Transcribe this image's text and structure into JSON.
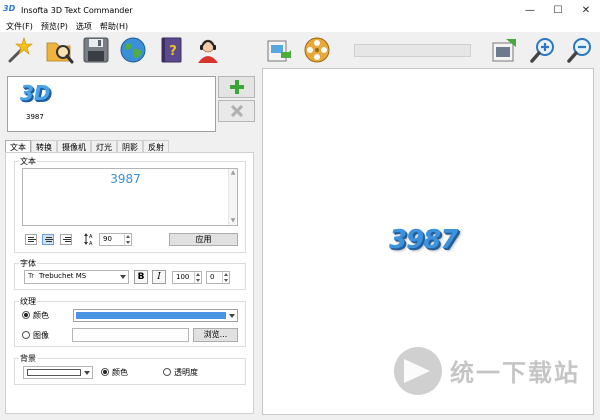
{
  "window": {
    "title": "Insofta 3D Text Commander",
    "minimize": "—",
    "maximize": "☐",
    "close": "✕"
  },
  "menu": [
    "文件(F)",
    "预览(P)",
    "选项",
    "帮助(H)"
  ],
  "toolbar": {
    "icons": [
      "magic-wand-icon",
      "open-folder-icon",
      "save-disk-icon",
      "globe-icon",
      "help-book-icon",
      "support-agent-icon",
      "export-image-icon",
      "film-reel-icon",
      "render-progress-icon",
      "zoom-in-icon",
      "zoom-out-icon"
    ]
  },
  "thumbnails": [
    {
      "glyph": "3D",
      "label": "3987"
    }
  ],
  "side_buttons": {
    "add": "+",
    "remove": "✕"
  },
  "tabs": [
    "文本",
    "转换",
    "摄像机",
    "灯光",
    "阴影",
    "反射"
  ],
  "text_group": {
    "label": "文本",
    "value": "3987",
    "line_spacing": "90",
    "apply_label": "应用"
  },
  "font_group": {
    "label": "字体",
    "font_name": "Trebuchet MS",
    "font_icon": "Tr",
    "bold": "B",
    "italic": "I",
    "size": "100",
    "spacing": "0"
  },
  "texture_group": {
    "label": "纹理",
    "color_label": "颜色",
    "image_label": "图像",
    "browse_label": "浏览...",
    "color": "#4b94e5",
    "selected": "color"
  },
  "background_group": {
    "label": "背景",
    "color_label": "颜色",
    "transparent_label": "透明度",
    "selected": "color"
  },
  "preview": {
    "text": "3987"
  },
  "watermark": {
    "text": "统一下载站"
  },
  "colors": {
    "accent": "#3c92dc",
    "add": "#3aa635",
    "remove": "#b0b0b0"
  }
}
